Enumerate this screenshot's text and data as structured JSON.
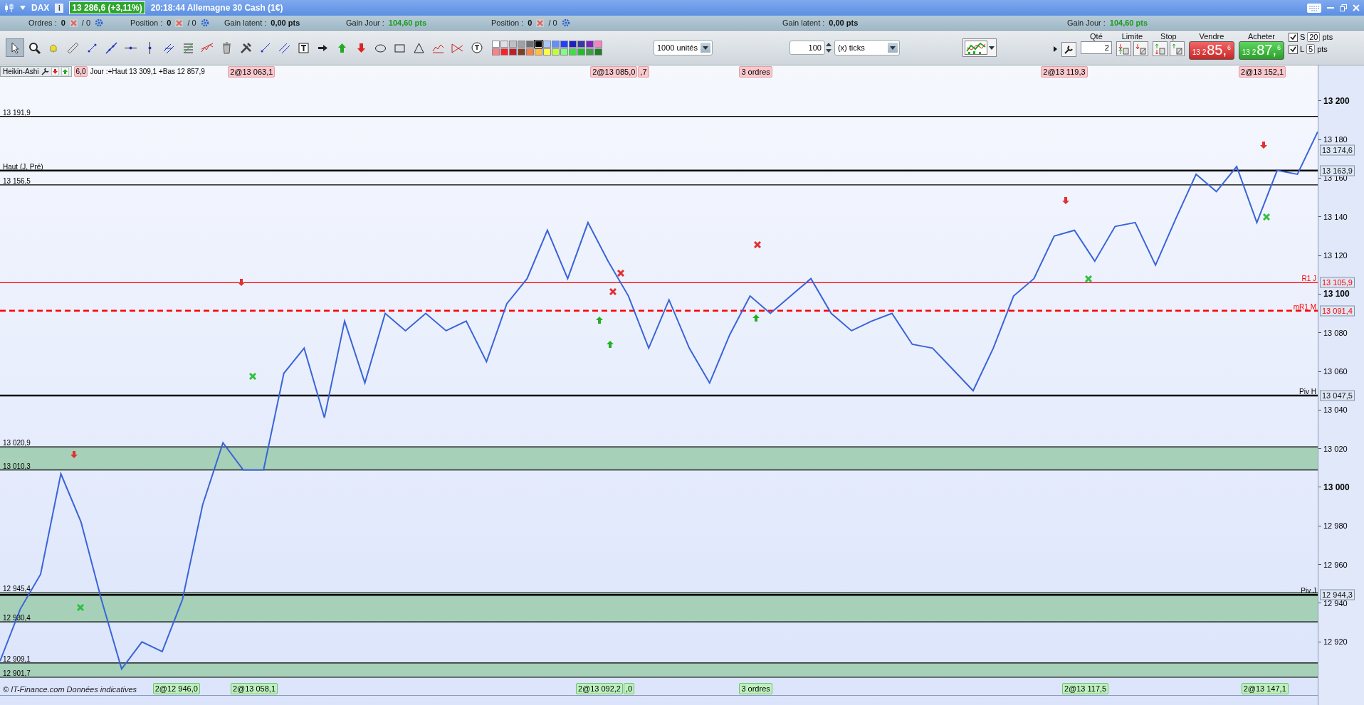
{
  "title_bar": {
    "symbol": "DAX",
    "info": "i",
    "quote": "13 286,6 (+3,11%)",
    "quote_up": true,
    "caption": "20:18:44 Allemagne 30 Cash (1€)"
  },
  "info_bar": [
    {
      "kind": "count",
      "label": "Ordres :",
      "value": "0",
      "value2": "/ 0"
    },
    {
      "kind": "count",
      "label": "Position :",
      "value": "0",
      "value2": "/ 0"
    },
    {
      "kind": "gain",
      "label": "Gain latent :",
      "value": "0,00 pts",
      "positive": false
    },
    {
      "kind": "gain",
      "label": "Gain Jour :",
      "value": "104,60 pts",
      "positive": true
    },
    {
      "kind": "count",
      "label": "Position :",
      "value": "0",
      "value2": "/ 0"
    },
    {
      "kind": "gain",
      "label": "Gain latent :",
      "value": "0,00 pts",
      "positive": false
    },
    {
      "kind": "gain",
      "label": "Gain Jour :",
      "value": "104,60 pts",
      "positive": true
    }
  ],
  "tools": [
    {
      "kind": "pointer",
      "selected": true
    },
    {
      "kind": "zoom",
      "selected": false
    },
    {
      "kind": "alert",
      "selected": false
    },
    {
      "kind": "ruler",
      "selected": false
    },
    {
      "kind": "segment",
      "selected": false
    },
    {
      "kind": "line",
      "selected": false
    },
    {
      "kind": "hline",
      "selected": false
    },
    {
      "kind": "vline",
      "selected": false
    },
    {
      "kind": "channel",
      "selected": false
    },
    {
      "kind": "fibonacci",
      "selected": false
    },
    {
      "kind": "trend",
      "selected": false
    },
    {
      "kind": "trash",
      "selected": false
    },
    {
      "kind": "tools",
      "selected": false
    },
    {
      "kind": "ray",
      "selected": false
    },
    {
      "kind": "parallel",
      "selected": false
    },
    {
      "kind": "text",
      "selected": false
    },
    {
      "kind": "arrow-right",
      "selected": false
    },
    {
      "kind": "arrow-up",
      "selected": false
    },
    {
      "kind": "arrow-down",
      "selected": false
    },
    {
      "kind": "ellipse",
      "selected": false
    },
    {
      "kind": "rectangle",
      "selected": false
    },
    {
      "kind": "triangle",
      "selected": false
    },
    {
      "kind": "pattern",
      "selected": false
    },
    {
      "kind": "pattern2",
      "selected": false
    },
    {
      "kind": "comment",
      "selected": false
    }
  ],
  "palette": [
    [
      {
        "color": "#ffffff",
        "selected": false
      },
      {
        "color": "#e0e0e0",
        "selected": false
      },
      {
        "color": "#c0c0c0",
        "selected": false
      },
      {
        "color": "#a0a0a0",
        "selected": false
      },
      {
        "color": "#707070",
        "selected": false
      },
      {
        "color": "#000000",
        "selected": true
      },
      {
        "color": "#a8c8ff",
        "selected": false
      },
      {
        "color": "#6090ff",
        "selected": false
      },
      {
        "color": "#2040ff",
        "selected": false
      },
      {
        "color": "#2020c0",
        "selected": false
      },
      {
        "color": "#3838a0",
        "selected": false
      },
      {
        "color": "#8020c0",
        "selected": false
      },
      {
        "color": "#ff80c0",
        "selected": false
      }
    ],
    [
      {
        "color": "#ff8080",
        "selected": false
      },
      {
        "color": "#ff2020",
        "selected": false
      },
      {
        "color": "#c02020",
        "selected": false
      },
      {
        "color": "#804020",
        "selected": false
      },
      {
        "color": "#ff8040",
        "selected": false
      },
      {
        "color": "#ffc040",
        "selected": false
      },
      {
        "color": "#ffff40",
        "selected": false
      },
      {
        "color": "#c0ff40",
        "selected": false
      },
      {
        "color": "#80ff80",
        "selected": false
      },
      {
        "color": "#40e040",
        "selected": false
      },
      {
        "color": "#20c020",
        "selected": false
      },
      {
        "color": "#40a040",
        "selected": false
      },
      {
        "color": "#208020",
        "selected": false
      }
    ]
  ],
  "units_select": {
    "value": "1000 unités"
  },
  "ticks": {
    "value": "100",
    "unit": "(x) ticks"
  },
  "order_panel": {
    "qty_label": "Qté",
    "qty": "2",
    "limit_label": "Limite",
    "stop_label": "Stop",
    "sell": {
      "label": "Vendre",
      "small": "13 2",
      "big": "85,",
      "sup": "6"
    },
    "buy": {
      "label": "Acheter",
      "small": "13 2",
      "big": "87,",
      "sup": "6"
    },
    "options": [
      {
        "label": "S",
        "checked": true,
        "value": "20",
        "unit": "pts"
      },
      {
        "label": "L",
        "checked": true,
        "value": "5",
        "unit": "pts"
      }
    ]
  },
  "chart": {
    "indicator": "Heikin-Ashi",
    "header_tag": "6,0",
    "header_text": "Jour :+Haut 13 309,1 +Bas 12 857,9",
    "copyright": "© IT-Finance.com Données indicatives",
    "top_tags": [
      {
        "text": "2@13 063,1"
      },
      {
        "text": "2@13 085,0",
        "suffix": ",7"
      },
      {
        "text": "3 ordres"
      },
      {
        "text": "2@13 119,3"
      },
      {
        "text": "2@13 152,1"
      }
    ],
    "bottom_tags": [
      {
        "text": "2@12 946,0"
      },
      {
        "text": "2@13 058,1"
      },
      {
        "text": "2@13 092,2",
        "suffix": ",0"
      },
      {
        "text": "3 ordres"
      },
      {
        "text": "2@13 117,5"
      },
      {
        "text": "2@13 147,1"
      }
    ],
    "chart_data": {
      "type": "line",
      "ylim": [
        12892.5,
        13218.3
      ],
      "yticks": [
        {
          "value": 13200,
          "label": "13 200"
        },
        {
          "value": 13180,
          "label": "13 180"
        },
        {
          "value": 13160,
          "label": "13 160"
        },
        {
          "value": 13140,
          "label": "13 140"
        },
        {
          "value": 13120,
          "label": "13 120"
        },
        {
          "value": 13100,
          "label": "13 100"
        },
        {
          "value": 13080,
          "label": "13 080"
        },
        {
          "value": 13060,
          "label": "13 060"
        },
        {
          "value": 13040,
          "label": "13 040"
        },
        {
          "value": 13020,
          "label": "13 020"
        },
        {
          "value": 13000,
          "label": "13 000"
        },
        {
          "value": 12980,
          "label": "12 980"
        },
        {
          "value": 12960,
          "label": "12 960"
        },
        {
          "value": 12940,
          "label": "12 940"
        },
        {
          "value": 12920,
          "label": "12 920"
        }
      ],
      "series": [
        {
          "color": "#3a64d8",
          "values": [
            12910,
            12937,
            12955,
            13007,
            12982,
            12942,
            12906,
            12920,
            12915,
            12942,
            12991,
            13023,
            13009,
            13009,
            13059,
            13072,
            13036,
            13086,
            13054,
            13090,
            13081,
            13090,
            13081,
            13086,
            13065,
            13095,
            13108,
            13133,
            13108,
            13137,
            13117,
            13099,
            13072,
            13097,
            13072,
            13054,
            13079,
            13099,
            13090,
            13099,
            13108,
            13090,
            13081,
            13086,
            13090,
            13074,
            13072,
            13061,
            13050,
            13072,
            13099,
            13108,
            13130,
            13133,
            13117,
            13135,
            13137,
            13115,
            13139,
            13162,
            13153,
            13166,
            13137,
            13164,
            13162,
            13184
          ]
        }
      ],
      "ref_lines": [
        {
          "axis": "y",
          "value": 13191.9,
          "color": "#000000",
          "label": "13 191,9"
        },
        {
          "axis": "y",
          "value": 13163.9,
          "color": "#000000",
          "label": "13 163,9"
        },
        {
          "axis": "y",
          "value": 13156.5,
          "color": "#000000",
          "label": "13 156,5"
        },
        {
          "axis": "y",
          "value": 13105.9,
          "color": "#ff0000",
          "label": "13 105,9"
        },
        {
          "axis": "y",
          "value": 13091.4,
          "color": "#ff0000",
          "label": "13 091,4"
        },
        {
          "axis": "y",
          "value": 13047.5,
          "color": "#000000",
          "label": "13 047,5"
        },
        {
          "axis": "y",
          "value": 12944.3,
          "color": "#000000",
          "label": "12 944,3"
        }
      ],
      "bands": [
        {
          "axis": "y",
          "from": 13009.0,
          "to": 13020.9,
          "color": "#a6d0b8"
        },
        {
          "axis": "y",
          "from": 12930.4,
          "to": 12945.4,
          "color": "#a6d0b8"
        },
        {
          "axis": "y",
          "from": 12901.7,
          "to": 12909.1,
          "color": "#a6d0b8"
        }
      ]
    },
    "last_price": "13 174,6",
    "line_names": [
      {
        "text": "Haut (J, Pré)"
      },
      {
        "text": "R1 J"
      },
      {
        "text": "mR1 M"
      },
      {
        "text": "Piv H"
      },
      {
        "text": "Piv J"
      }
    ],
    "band_labels": [
      {
        "top": "13 020,9",
        "bottom": "13 010,3"
      },
      {
        "top": "12 945,4",
        "bottom": "12 930,4"
      },
      {
        "top": "12 909,1",
        "bottom": "12 901,7"
      }
    ]
  }
}
